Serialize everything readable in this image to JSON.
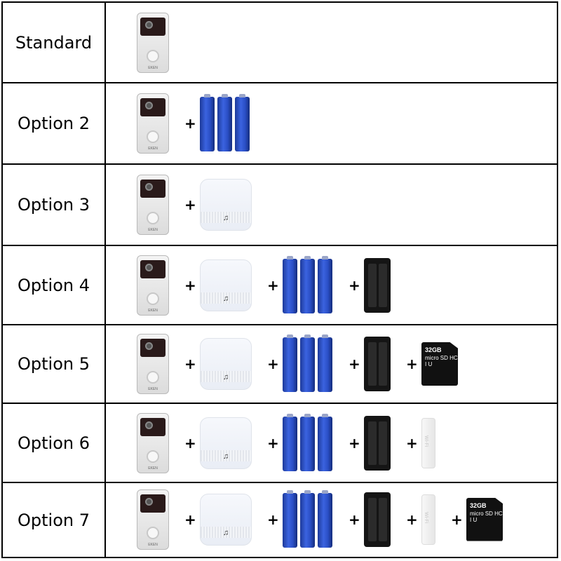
{
  "rows": [
    {
      "label": "Standard",
      "items": [
        "doorbell"
      ]
    },
    {
      "label": "Option 2",
      "items": [
        "doorbell",
        "batteries"
      ]
    },
    {
      "label": "Option 3",
      "items": [
        "doorbell",
        "chime"
      ]
    },
    {
      "label": "Option 4",
      "items": [
        "doorbell",
        "chime",
        "batteries",
        "charger"
      ]
    },
    {
      "label": "Option 5",
      "items": [
        "doorbell",
        "chime",
        "batteries",
        "charger",
        "sd-card"
      ]
    },
    {
      "label": "Option 6",
      "items": [
        "doorbell",
        "chime",
        "batteries",
        "charger",
        "wifi-repeater"
      ]
    },
    {
      "label": "Option 7",
      "items": [
        "doorbell",
        "chime",
        "batteries",
        "charger",
        "wifi-repeater",
        "sd-card"
      ]
    }
  ],
  "plus_sign": "+",
  "doorbell": {
    "brand": "EKEN"
  },
  "sd_card": {
    "size": "32GB",
    "logo": "micro SD HC I U"
  },
  "wifi_repeater": {
    "mark": "Wi-Fi"
  },
  "colors": {
    "border": "#000000",
    "battery": "#2a4ec4",
    "charger": "#151515",
    "sd_card": "#111111"
  }
}
